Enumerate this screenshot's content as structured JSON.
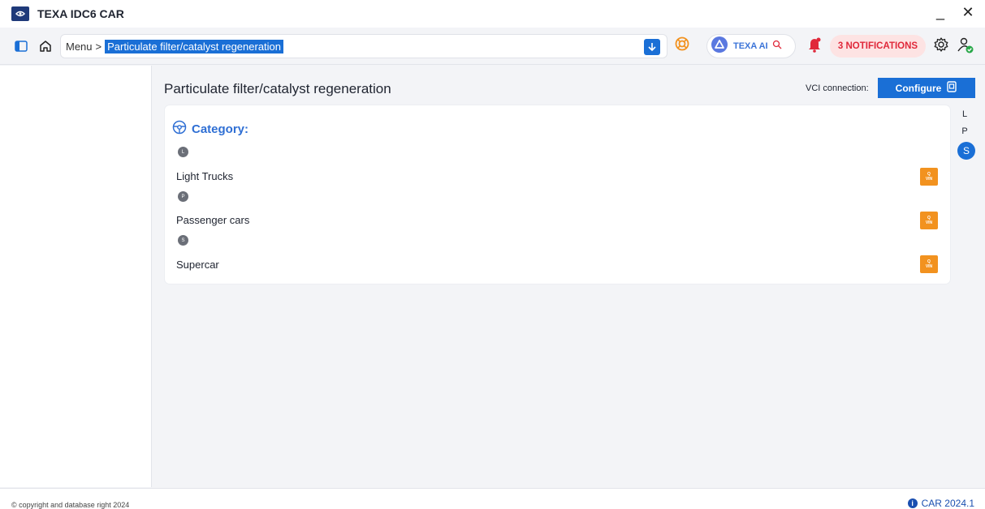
{
  "app": {
    "title": "TEXA IDC6 CAR"
  },
  "window": {
    "minimize_glyph": "_",
    "close_glyph": "✕"
  },
  "toolbar": {
    "breadcrumb_root": "Menu",
    "breadcrumb_sep": ">",
    "breadcrumb_current": "Particulate filter/catalyst regeneration",
    "ai_label": "TEXA AI",
    "notifications_label": "3 NOTIFICATIONS"
  },
  "page": {
    "title": "Particulate filter/catalyst regeneration",
    "vci_label": "VCI connection:",
    "configure_label": "Configure"
  },
  "category": {
    "title": "Category:",
    "items": [
      {
        "letter": "L",
        "label": "Light Trucks"
      },
      {
        "letter": "P",
        "label": "Passenger cars"
      },
      {
        "letter": "S",
        "label": "Supercar"
      }
    ],
    "vin_top": "Q",
    "vin_bottom": "VIN"
  },
  "index": {
    "items": [
      "L",
      "P"
    ],
    "active": "S"
  },
  "footer": {
    "copyright": "© copyright and database right 2024",
    "version": "CAR 2024.1",
    "info_glyph": "i"
  },
  "colors": {
    "accent": "#1a6fd6",
    "notification": "#e0283a",
    "vin": "#f2921f"
  }
}
